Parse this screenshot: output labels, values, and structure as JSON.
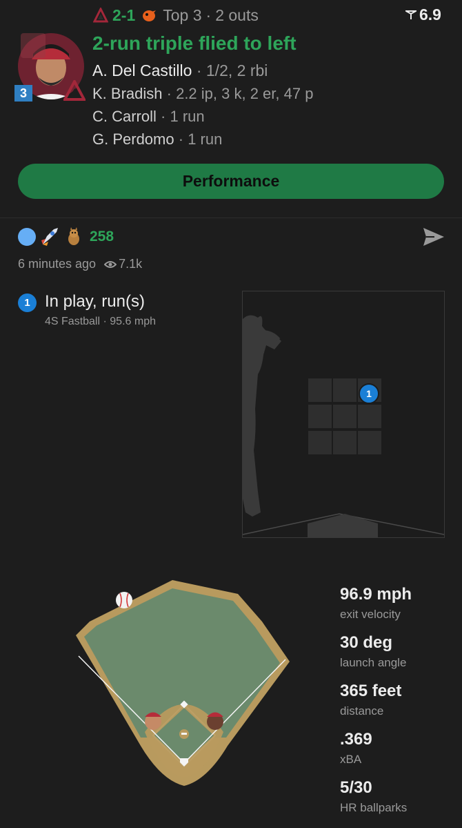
{
  "game": {
    "score": "2-1",
    "inning": "Top 3",
    "outs": "2 outs",
    "rating": "6.9",
    "away_logo_icon": "diamondbacks-logo-icon",
    "home_logo_icon": "orioles-logo-icon"
  },
  "play": {
    "headline": "2-run triple flied to left",
    "batter_name": "A. Del Castillo",
    "batter_line": "1/2, 2 rbi",
    "pitcher_name": "K. Bradish",
    "pitcher_line": "2.2 ip, 3 k, 2 er, 47 p",
    "runners": [
      {
        "name": "C. Carroll",
        "detail": "1 run"
      },
      {
        "name": "G. Perdomo",
        "detail": "1 run"
      }
    ],
    "jersey_number": "3"
  },
  "performance_button": "Performance",
  "social": {
    "reaction_count": "258",
    "time_ago": "6 minutes ago",
    "views": "7.1k"
  },
  "pitch": {
    "number": "1",
    "result": "In play, run(s)",
    "pitch_type": "4S Fastball",
    "velocity": "95.6 mph"
  },
  "stats": [
    {
      "value": "96.9 mph",
      "label": "exit velocity"
    },
    {
      "value": "30 deg",
      "label": "launch angle"
    },
    {
      "value": "365 feet",
      "label": "distance"
    },
    {
      "value": ".369",
      "label": "xBA"
    },
    {
      "value": "5/30",
      "label": "HR ballparks"
    }
  ],
  "colors": {
    "accent_green": "#2ea55a",
    "button_green": "#1f7a45",
    "pitch_blue": "#1a7fd6",
    "field_green": "#6b8a6c",
    "dirt_tan": "#b89a5e"
  }
}
